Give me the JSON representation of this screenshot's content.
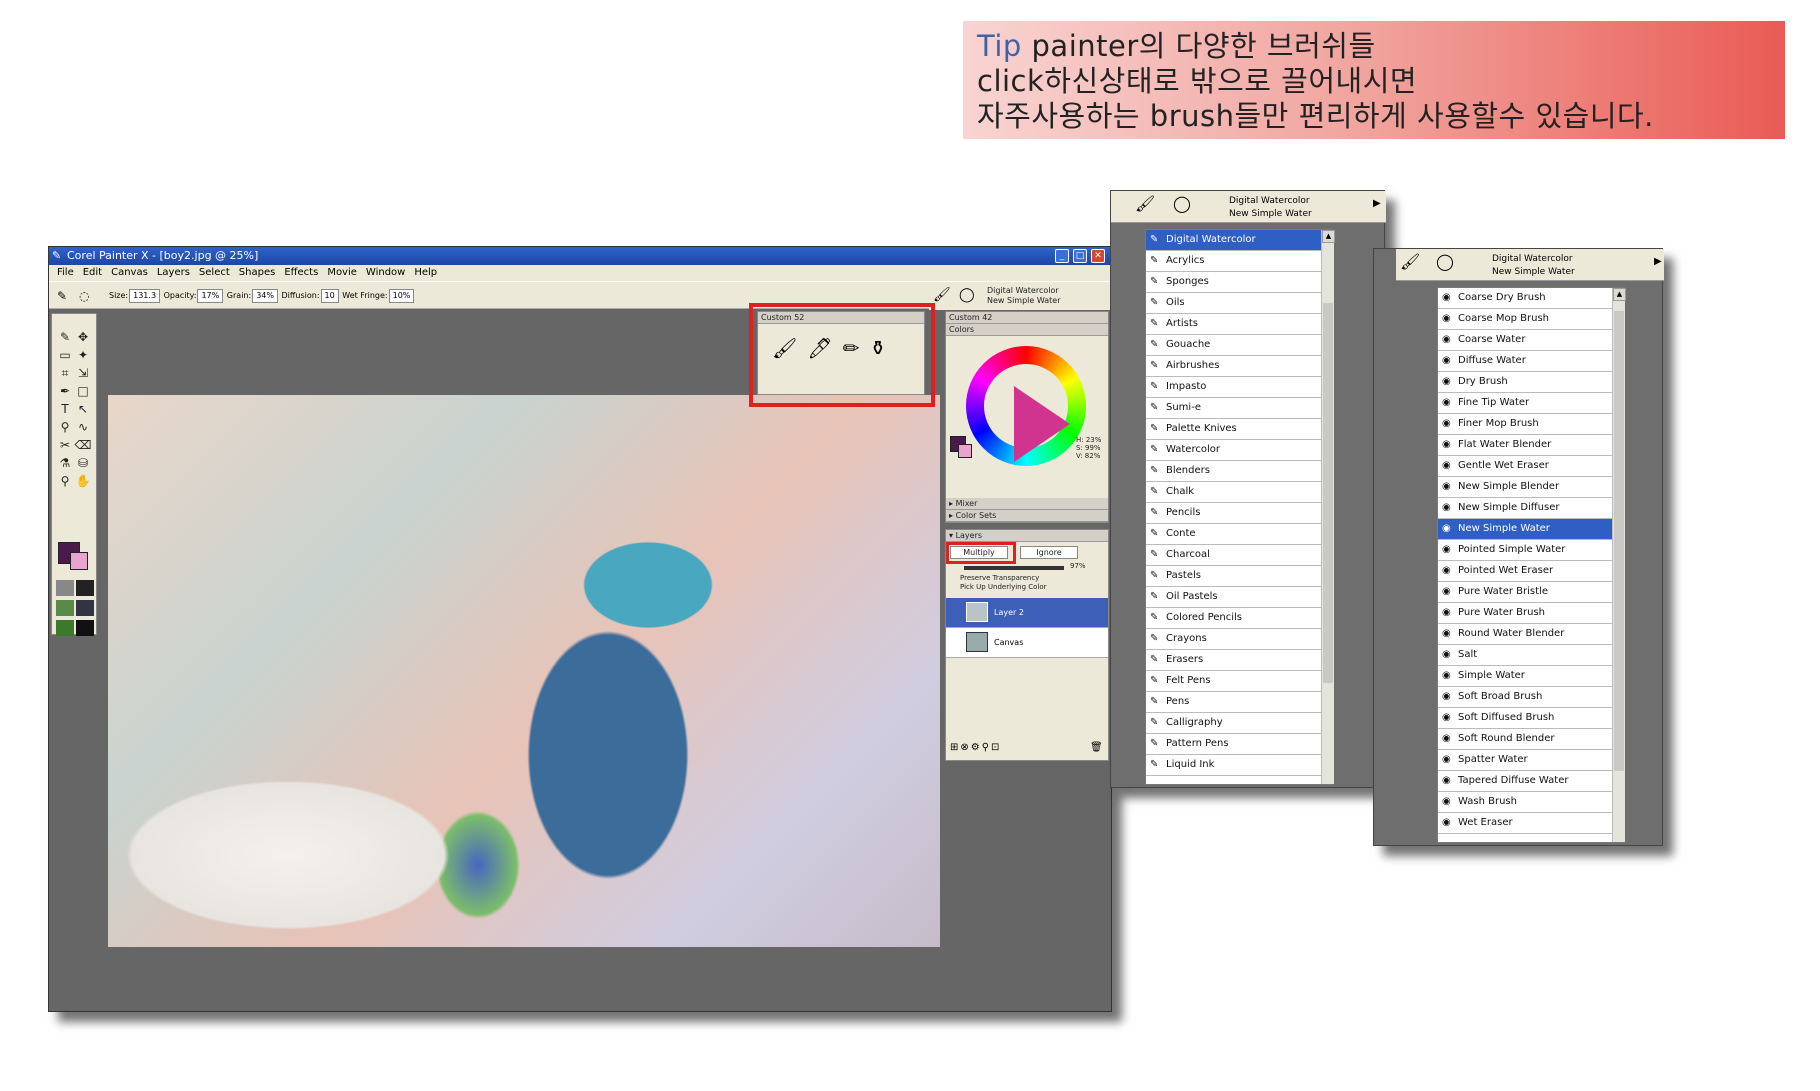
{
  "tip": {
    "keyword": "Tip",
    "line1_rest": " painter의 다양한 브러쉬들",
    "line2": "click하신상태로 밖으로 끌어내시면",
    "line3": "자주사용하는 brush들만 편리하게 사용할수 있습니다."
  },
  "window": {
    "title": "Corel Painter X - [boy2.jpg @ 25%]",
    "menus": [
      "File",
      "Edit",
      "Canvas",
      "Layers",
      "Select",
      "Shapes",
      "Effects",
      "Movie",
      "Window",
      "Help"
    ]
  },
  "properties": {
    "size_label": "Size:",
    "size": "131.3",
    "opacity_label": "Opacity:",
    "opacity": "17%",
    "grain_label": "Grain:",
    "grain": "34%",
    "diffusion_label": "Diffusion:",
    "diffusion": "10",
    "wet_fringe_label": "Wet Fringe:",
    "wet_fringe": "10%"
  },
  "brush_selector": {
    "category": "Digital Watercolor",
    "variant": "New Simple Water"
  },
  "custom52": {
    "title": "Custom 52"
  },
  "right_panel": {
    "custom42": "Custom 42",
    "colors": "Colors",
    "hsv": [
      "H: 23%",
      "S: 99%",
      "V: 82%"
    ],
    "mixer": "Mixer",
    "color_sets": "Color Sets"
  },
  "layers": {
    "title": "Layers",
    "composite_method": "Multiply",
    "ignore": "Ignore",
    "opacity": "97%",
    "preserve": "Preserve Transparency",
    "pickup": "Pick Up Underlying Color",
    "items": [
      "Layer 2",
      "Canvas"
    ]
  },
  "categories": [
    "Digital Watercolor",
    "Acrylics",
    "Sponges",
    "Oils",
    "Artists",
    "Gouache",
    "Airbrushes",
    "Impasto",
    "Sumi-e",
    "Palette Knives",
    "Watercolor",
    "Blenders",
    "Chalk",
    "Pencils",
    "Conte",
    "Charcoal",
    "Pastels",
    "Oil Pastels",
    "Colored Pencils",
    "Crayons",
    "Erasers",
    "Felt Pens",
    "Pens",
    "Calligraphy",
    "Pattern Pens",
    "Liquid Ink"
  ],
  "variants": [
    "Coarse Dry Brush",
    "Coarse Mop Brush",
    "Coarse Water",
    "Diffuse Water",
    "Dry Brush",
    "Fine Tip Water",
    "Finer Mop Brush",
    "Flat Water Blender",
    "Gentle Wet Eraser",
    "New Simple Blender",
    "New Simple Diffuser",
    "New Simple Water",
    "Pointed Simple Water",
    "Pointed Wet Eraser",
    "Pure Water Bristle",
    "Pure Water Brush",
    "Round Water Blender",
    "Salt",
    "Simple Water",
    "Soft Broad Brush",
    "Soft Diffused Brush",
    "Soft Round Blender",
    "Spatter Water",
    "Tapered Diffuse Water",
    "Wash Brush",
    "Wet Eraser"
  ],
  "colors": {
    "title_blue": "#1d46a6",
    "selection": "#2f5fc4",
    "highlight_red": "#e02020"
  }
}
